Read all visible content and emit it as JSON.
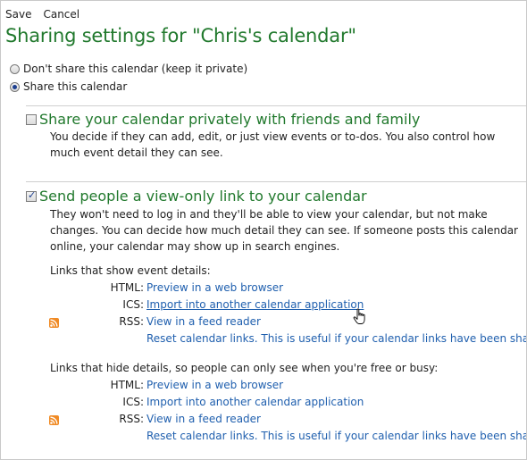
{
  "toolbar": {
    "save_label": "Save",
    "cancel_label": "Cancel"
  },
  "page_title": "Sharing settings for \"Chris's calendar\"",
  "sharing_options": {
    "private_label": "Don't share this calendar (keep it private)",
    "share_label": "Share this calendar",
    "selected": "share"
  },
  "friends_section": {
    "checked": false,
    "title": "Share your calendar privately with friends and family",
    "description": "You decide if they can add, edit, or just view events or to-dos. You also control how much event detail they can see."
  },
  "viewonly_section": {
    "checked": true,
    "title": "Send people a view-only link to your calendar",
    "description": "They won't need to log in and they'll be able to view your calendar, but not make changes. You can decide how much detail they can see. If someone posts this calendar online, your calendar may show up in search engines.",
    "details_group": {
      "heading": "Links that show event details:",
      "html_label": "HTML:",
      "html_link": "Preview in a web browser",
      "ics_label": "ICS:",
      "ics_link": "Import into another calendar application",
      "rss_label": "RSS:",
      "rss_link": "View in a feed reader",
      "reset_link": "Reset calendar links. This is useful if your calendar links have been shared"
    },
    "busy_group": {
      "heading": "Links that hide details, so people can only see when you're free or busy:",
      "html_label": "HTML:",
      "html_link": "Preview in a web browser",
      "ics_label": "ICS:",
      "ics_link": "Import into another calendar application",
      "rss_label": "RSS:",
      "rss_link": "View in a feed reader",
      "reset_link": "Reset calendar links. This is useful if your calendar links have been shared"
    }
  },
  "colors": {
    "title_green": "#21792d",
    "link_blue": "#1f5fae",
    "rss_orange": "#f08a24"
  },
  "icons": {
    "rss": "rss-icon",
    "cursor": "hand-pointer-icon"
  }
}
